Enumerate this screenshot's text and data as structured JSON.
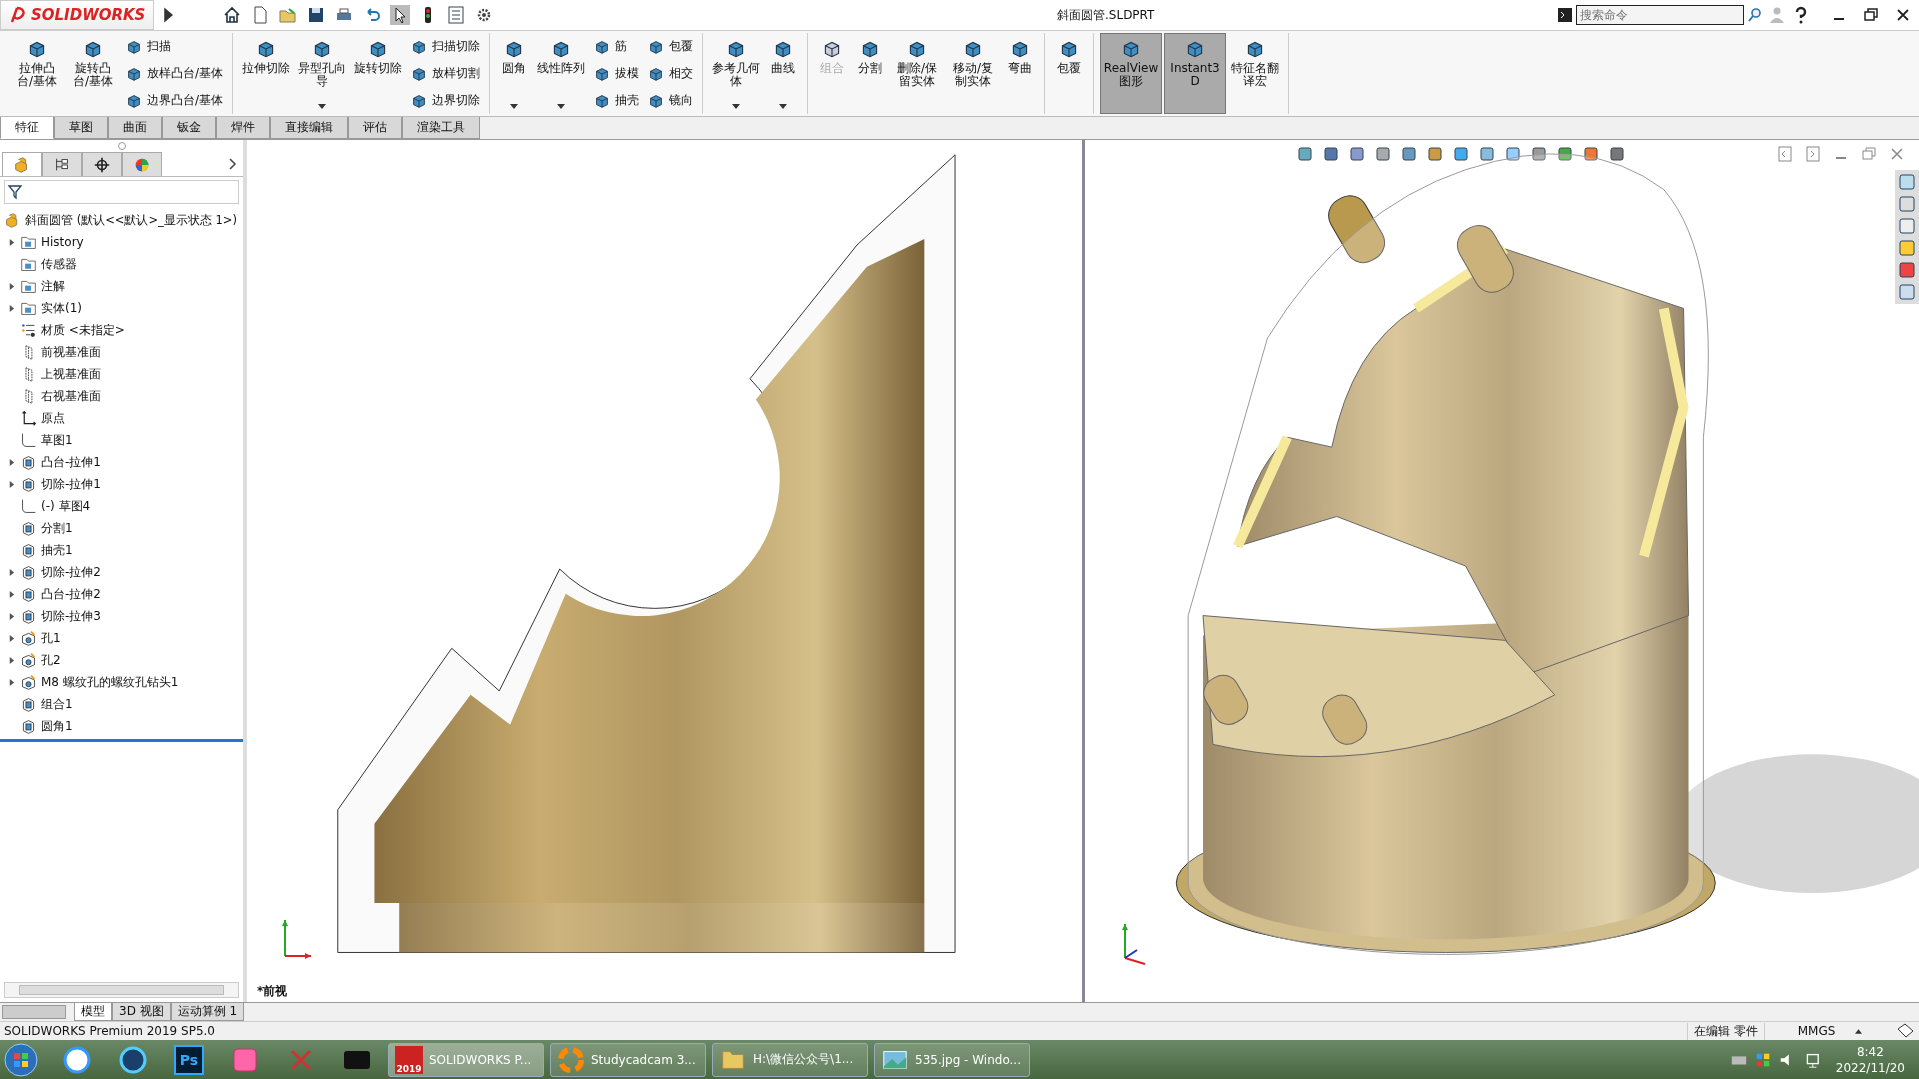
{
  "titlebar": {
    "logo": "SOLIDWORKS",
    "title": "斜面圆管.SLDPRT",
    "search_placeholder": "搜索命令"
  },
  "ribbon": [
    {
      "columns": [
        {
          "kind": "large",
          "label": "拉伸凸台/基体",
          "pressed": false,
          "disabled": false,
          "dropdown": false
        },
        {
          "kind": "large",
          "label": "旋转凸台/基体",
          "pressed": false,
          "disabled": false,
          "dropdown": false
        },
        {
          "kind": "stack",
          "items": [
            {
              "label": "扫描"
            },
            {
              "label": "放样凸台/基体"
            },
            {
              "label": "边界凸台/基体"
            }
          ]
        }
      ]
    },
    {
      "columns": [
        {
          "kind": "large",
          "label": "拉伸切除",
          "pressed": false,
          "disabled": false,
          "dropdown": false
        },
        {
          "kind": "large",
          "label": "异型孔向导",
          "pressed": false,
          "disabled": false,
          "dropdown": true
        },
        {
          "kind": "large",
          "label": "旋转切除",
          "pressed": false,
          "disabled": false,
          "dropdown": false
        },
        {
          "kind": "stack",
          "items": [
            {
              "label": "扫描切除"
            },
            {
              "label": "放样切割"
            },
            {
              "label": "边界切除"
            }
          ]
        }
      ]
    },
    {
      "columns": [
        {
          "kind": "large",
          "label": "圆角",
          "pressed": false,
          "disabled": false,
          "dropdown": true
        },
        {
          "kind": "large",
          "label": "线性阵列",
          "pressed": false,
          "disabled": false,
          "dropdown": true
        },
        {
          "kind": "stack",
          "items": [
            {
              "label": "筋"
            },
            {
              "label": "拔模"
            },
            {
              "label": "抽壳"
            }
          ]
        },
        {
          "kind": "stack",
          "items": [
            {
              "label": "包覆"
            },
            {
              "label": "相交"
            },
            {
              "label": "镜向"
            }
          ]
        }
      ]
    },
    {
      "columns": [
        {
          "kind": "large",
          "label": "参考几何体",
          "pressed": false,
          "disabled": false,
          "dropdown": true
        },
        {
          "kind": "large",
          "label": "曲线",
          "pressed": false,
          "disabled": false,
          "dropdown": true
        }
      ]
    },
    {
      "columns": [
        {
          "kind": "large",
          "label": "组合",
          "pressed": false,
          "disabled": true,
          "dropdown": false
        },
        {
          "kind": "large",
          "label": "分割",
          "pressed": false,
          "disabled": false,
          "dropdown": false
        },
        {
          "kind": "large",
          "label": "删除/保留实体",
          "pressed": false,
          "disabled": false,
          "dropdown": false
        },
        {
          "kind": "large",
          "label": "移动/复制实体",
          "pressed": false,
          "disabled": false,
          "dropdown": false
        },
        {
          "kind": "large",
          "label": "弯曲",
          "pressed": false,
          "disabled": false,
          "dropdown": false
        }
      ]
    },
    {
      "columns": [
        {
          "kind": "large",
          "label": "包覆",
          "pressed": false,
          "disabled": false,
          "dropdown": false
        }
      ]
    },
    {
      "columns": [
        {
          "kind": "large",
          "label": "RealView图形",
          "pressed": true,
          "disabled": false,
          "dropdown": false
        },
        {
          "kind": "large",
          "label": "Instant3D",
          "pressed": true,
          "disabled": false,
          "dropdown": false
        },
        {
          "kind": "large",
          "label": "特征名翻译宏",
          "pressed": false,
          "disabled": false,
          "dropdown": false
        }
      ]
    }
  ],
  "tabs": [
    {
      "label": "特征",
      "selected": true
    },
    {
      "label": "草图",
      "selected": false
    },
    {
      "label": "曲面",
      "selected": false
    },
    {
      "label": "钣金",
      "selected": false
    },
    {
      "label": "焊件",
      "selected": false
    },
    {
      "label": "直接编辑",
      "selected": false
    },
    {
      "label": "评估",
      "selected": false
    },
    {
      "label": "渲染工具",
      "selected": false
    }
  ],
  "panel_tabs": [
    {
      "kind": "feature",
      "selected": true
    },
    {
      "kind": "property",
      "selected": false
    },
    {
      "kind": "config",
      "selected": false
    },
    {
      "kind": "display",
      "selected": false
    }
  ],
  "tree": {
    "root": "斜面圆管  (默认<<默认>_显示状态 1>)",
    "items": [
      {
        "label": "History",
        "kind": "folder",
        "expandable": true
      },
      {
        "label": "传感器",
        "kind": "folder",
        "expandable": false
      },
      {
        "label": "注解",
        "kind": "folder",
        "expandable": true
      },
      {
        "label": "实体(1)",
        "kind": "folder",
        "expandable": true
      },
      {
        "label": "材质 <未指定>",
        "kind": "material",
        "expandable": false
      },
      {
        "label": "前视基准面",
        "kind": "plane",
        "expandable": false
      },
      {
        "label": "上视基准面",
        "kind": "plane",
        "expandable": false
      },
      {
        "label": "右视基准面",
        "kind": "plane",
        "expandable": false
      },
      {
        "label": "原点",
        "kind": "origin",
        "expandable": false
      },
      {
        "label": "草图1",
        "kind": "sketch",
        "expandable": false
      },
      {
        "label": "凸台-拉伸1",
        "kind": "feature",
        "expandable": true
      },
      {
        "label": "切除-拉伸1",
        "kind": "feature",
        "expandable": true
      },
      {
        "label": "(-) 草图4",
        "kind": "sketch",
        "expandable": false
      },
      {
        "label": "分割1",
        "kind": "feature",
        "expandable": false
      },
      {
        "label": "抽壳1",
        "kind": "feature",
        "expandable": false
      },
      {
        "label": "切除-拉伸2",
        "kind": "feature",
        "expandable": true
      },
      {
        "label": "凸台-拉伸2",
        "kind": "feature",
        "expandable": true
      },
      {
        "label": "切除-拉伸3",
        "kind": "feature",
        "expandable": true
      },
      {
        "label": "孔1",
        "kind": "hole",
        "expandable": true
      },
      {
        "label": "孔2",
        "kind": "hole",
        "expandable": true
      },
      {
        "label": "M8 螺纹孔的螺纹孔钻头1",
        "kind": "hole",
        "expandable": true
      },
      {
        "label": "组合1",
        "kind": "feature",
        "expandable": false
      },
      {
        "label": "圆角1",
        "kind": "feature",
        "expandable": false
      }
    ]
  },
  "viewports": {
    "left_label": "*前视"
  },
  "bottom_tabs": [
    {
      "label": "模型",
      "selected": true
    },
    {
      "label": "3D 视图",
      "selected": false
    },
    {
      "label": "运动算例 1",
      "selected": false
    }
  ],
  "status_bar": {
    "product": "SOLIDWORKS Premium 2019 SP5.0",
    "mode": "在编辑 零件",
    "units": "MMGS"
  },
  "taskbar": {
    "pinned": [
      {
        "kind": "cloud"
      },
      {
        "kind": "aperture"
      },
      {
        "kind": "badge",
        "text": "Ps"
      },
      {
        "kind": "photos"
      },
      {
        "kind": "scissors"
      },
      {
        "kind": "recorder"
      }
    ],
    "tasks": [
      {
        "label": "SOLIDWORKS P...",
        "kind": "sw",
        "icon_text": "2019",
        "selected": true
      },
      {
        "label": "Studycadcam 3...",
        "kind": "ring",
        "selected": false
      },
      {
        "label": "H:\\微信公众号\\1...",
        "kind": "folder",
        "selected": false
      },
      {
        "label": "535.jpg - Windo...",
        "kind": "picture",
        "selected": false
      }
    ],
    "time": "8:42",
    "date": "2022/11/20"
  }
}
